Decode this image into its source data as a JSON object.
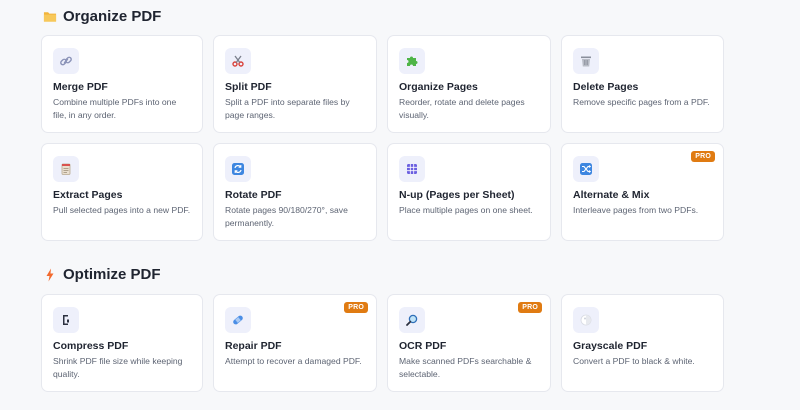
{
  "sections": [
    {
      "title": "Organize PDF",
      "icon": "folder-icon",
      "cards": [
        {
          "title": "Merge PDF",
          "desc": "Combine multiple PDFs into one file, in any order.",
          "icon": "link-icon"
        },
        {
          "title": "Split PDF",
          "desc": "Split a PDF into separate files by page ranges.",
          "icon": "scissors-icon"
        },
        {
          "title": "Organize Pages",
          "desc": "Reorder, rotate and delete pages visually.",
          "icon": "puzzle-icon"
        },
        {
          "title": "Delete Pages",
          "desc": "Remove specific pages from a PDF.",
          "icon": "trash-icon"
        },
        {
          "title": "Extract Pages",
          "desc": "Pull selected pages into a new PDF.",
          "icon": "notepad-icon"
        },
        {
          "title": "Rotate PDF",
          "desc": "Rotate pages 90/180/270°, save permanently.",
          "icon": "rotate-icon"
        },
        {
          "title": "N-up (Pages per Sheet)",
          "desc": "Place multiple pages on one sheet.",
          "icon": "grid-icon"
        },
        {
          "title": "Alternate & Mix",
          "desc": "Interleave pages from two PDFs.",
          "icon": "shuffle-icon",
          "badge": "PRO"
        }
      ]
    },
    {
      "title": "Optimize PDF",
      "icon": "lightning-icon",
      "cards": [
        {
          "title": "Compress PDF",
          "desc": "Shrink PDF file size while keeping quality.",
          "icon": "compress-icon"
        },
        {
          "title": "Repair PDF",
          "desc": "Attempt to recover a damaged PDF.",
          "icon": "bandage-icon",
          "badge": "PRO"
        },
        {
          "title": "OCR PDF",
          "desc": "Make scanned PDFs searchable & selectable.",
          "icon": "magnifier-icon",
          "badge": "PRO"
        },
        {
          "title": "Grayscale PDF",
          "desc": "Convert a PDF to black & white.",
          "icon": "grayscale-icon"
        }
      ]
    }
  ],
  "colors": {
    "pro_badge": "#e07b12",
    "icon_bg": "#eef0fb",
    "card_border": "#e6e8ee"
  }
}
